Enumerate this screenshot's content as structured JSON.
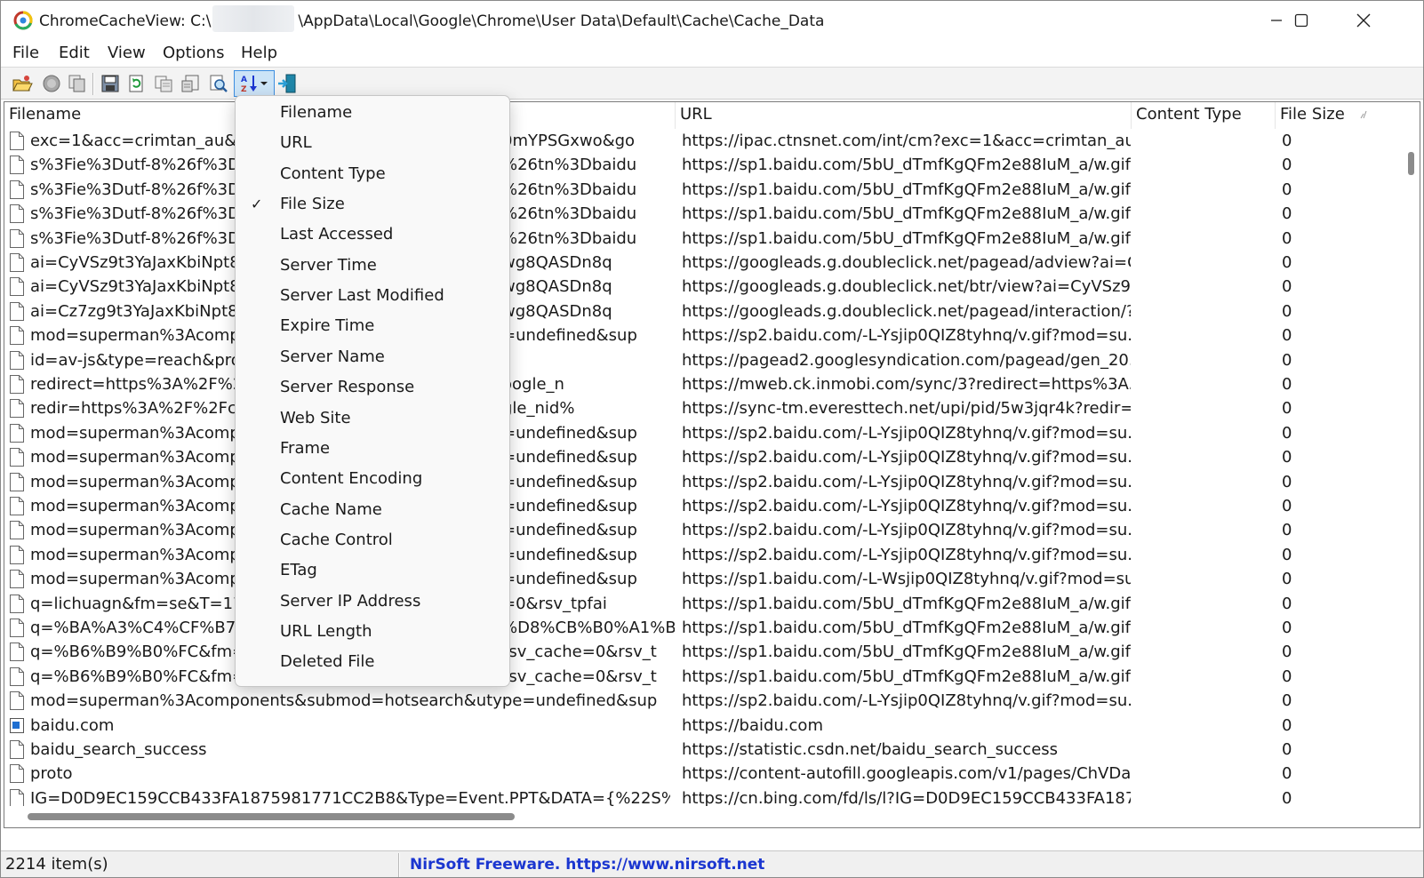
{
  "window": {
    "title_prefix": "ChromeCacheView:  C:\\",
    "title_suffix": "\\AppData\\Local\\Google\\Chrome\\User Data\\Default\\Cache\\Cache_Data"
  },
  "menu": [
    "File",
    "Edit",
    "View",
    "Options",
    "Help"
  ],
  "toolbar": {
    "icons": [
      "open-folder-icon",
      "stop-icon",
      "copy-files-icon",
      "save-icon",
      "refresh-icon",
      "copy-icon",
      "html-report-icon",
      "properties-icon",
      "find-icon",
      "sort-icon",
      "exit-icon"
    ]
  },
  "columns": {
    "filename": "Filename",
    "url": "URL",
    "content_type": "Content Type",
    "file_size": "File Size"
  },
  "rows": [
    {
      "name": "exc=1&acc=crimtan_au&g",
      "name_tail": "0mYPSGxwo&go",
      "url": "https://ipac.ctnsnet.com/int/cm?exc=1&acc=crimtan_au...",
      "size": "0"
    },
    {
      "name": "s%3Fie%3Dutf-8%26f%3D3",
      "name_tail": "%26tn%3Dbaidu",
      "url": "https://sp1.baidu.com/5bU_dTmfKgQFm2e88IuM_a/w.gif...",
      "size": "0"
    },
    {
      "name": "s%3Fie%3Dutf-8%26f%3D3",
      "name_tail": "%26tn%3Dbaidu",
      "url": "https://sp1.baidu.com/5bU_dTmfKgQFm2e88IuM_a/w.gif...",
      "size": "0"
    },
    {
      "name": "s%3Fie%3Dutf-8%26f%3D3",
      "name_tail": "%26tn%3Dbaidu",
      "url": "https://sp1.baidu.com/5bU_dTmfKgQFm2e88IuM_a/w.gif...",
      "size": "0"
    },
    {
      "name": "s%3Fie%3Dutf-8%26f%3D3",
      "name_tail": "%26tn%3Dbaidu",
      "url": "https://sp1.baidu.com/5bU_dTmfKgQFm2e88IuM_a/w.gif...",
      "size": "0"
    },
    {
      "name": "ai=CyVSz9t3YaJaxKbiNpt8I",
      "name_tail": "wg8QASDn8q",
      "url": "https://googleads.g.doubleclick.net/pagead/adview?ai=C...",
      "size": "0"
    },
    {
      "name": "ai=CyVSz9t3YaJaxKbiNpt8I",
      "name_tail": "wg8QASDn8q",
      "url": "https://googleads.g.doubleclick.net/btr/view?ai=CyVSz9t...",
      "size": "0"
    },
    {
      "name": "ai=Cz7zg9t3YaJaxKbiNpt8I",
      "name_tail": "wg8QASDn8q",
      "url": "https://googleads.g.doubleclick.net/pagead/interaction/?...",
      "size": "0"
    },
    {
      "name": "mod=superman%3Acompo",
      "name_tail": "=undefined&sup",
      "url": "https://sp2.baidu.com/-L-Ysjip0QIZ8tyhnq/v.gif?mod=su...",
      "size": "0"
    },
    {
      "name": "id=av-js&type=reach&pro",
      "name_tail": "",
      "url": "https://pagead2.googlesyndication.com/pagead/gen_20...",
      "size": "0"
    },
    {
      "name": "redirect=https%3A%2F%2I",
      "name_tail": "oogle_n",
      "url": "https://mweb.ck.inmobi.com/sync/3?redirect=https%3A...",
      "size": "0"
    },
    {
      "name": "redir=https%3A%2F%2Fcm",
      "name_tail": "gle_nid%",
      "url": "https://sync-tm.everesttech.net/upi/pid/5w3jqr4k?redir=...",
      "size": "0"
    },
    {
      "name": "mod=superman%3Acompo",
      "name_tail": "=undefined&sup",
      "url": "https://sp2.baidu.com/-L-Ysjip0QIZ8tyhnq/v.gif?mod=su...",
      "size": "0"
    },
    {
      "name": "mod=superman%3Acompo",
      "name_tail": "=undefined&sup",
      "url": "https://sp2.baidu.com/-L-Ysjip0QIZ8tyhnq/v.gif?mod=su...",
      "size": "0"
    },
    {
      "name": "mod=superman%3Acompo",
      "name_tail": "=undefined&sup",
      "url": "https://sp2.baidu.com/-L-Ysjip0QIZ8tyhnq/v.gif?mod=su...",
      "size": "0"
    },
    {
      "name": "mod=superman%3Acompo",
      "name_tail": "=undefined&sup",
      "url": "https://sp2.baidu.com/-L-Ysjip0QIZ8tyhnq/v.gif?mod=su...",
      "size": "0"
    },
    {
      "name": "mod=superman%3Acompo",
      "name_tail": "=undefined&sup",
      "url": "https://sp2.baidu.com/-L-Ysjip0QIZ8tyhnq/v.gif?mod=su...",
      "size": "0"
    },
    {
      "name": "mod=superman%3Acompo",
      "name_tail": "=undefined&sup",
      "url": "https://sp2.baidu.com/-L-Ysjip0QIZ8tyhnq/v.gif?mod=su...",
      "size": "0"
    },
    {
      "name": "mod=superman%3Acompo",
      "name_tail": "=undefined&sup",
      "url": "https://sp1.baidu.com/-L-Wsjip0QIZ8tyhnq/v.gif?mod=su...",
      "size": "0"
    },
    {
      "name": "q=lichuagn&fm=se&T=17",
      "name_tail": "=0&rsv_tpfai",
      "url": "https://sp1.baidu.com/5bU_dTmfKgQFm2e88IuM_a/w.gif...",
      "size": "0"
    },
    {
      "name": "q=%BA%A3%C4%CF%B7%",
      "name_tail": "%D8%CB%B0%A1%B...",
      "url": "https://sp1.baidu.com/5bU_dTmfKgQFm2e88IuM_a/w.gif...",
      "size": "0"
    },
    {
      "name": "q=%B6%B9%B0%FC&fm=s",
      "name_tail": "rsv_cache=0&rsv_t",
      "url": "https://sp1.baidu.com/5bU_dTmfKgQFm2e88IuM_a/w.gif...",
      "size": "0"
    },
    {
      "name": "q=%B6%B9%B0%FC&fm=s",
      "name_tail": "rsv_cache=0&rsv_t",
      "url": "https://sp1.baidu.com/5bU_dTmfKgQFm2e88IuM_a/w.gif...",
      "size": "0"
    },
    {
      "name": "mod=superman%3Acomponents&submod=hotsearch&utype=undefined&sup",
      "name_tail": "",
      "url": "https://sp2.baidu.com/-L-Ysjip0QIZ8tyhnq/v.gif?mod=su...",
      "size": "0"
    },
    {
      "name": "baidu.com",
      "name_tail": "",
      "url": "https://baidu.com",
      "size": "0"
    },
    {
      "name": "baidu_search_success",
      "name_tail": "",
      "url": "https://statistic.csdn.net/baidu_search_success",
      "size": "0"
    },
    {
      "name": "proto",
      "name_tail": "",
      "url": "https://content-autofill.googleapis.com/v1/pages/ChVDa...",
      "size": "0"
    },
    {
      "name": "IG=D0D9EC159CCB433FA1875981771CC2B8&Type=Event.PPT&DATA={%22S%",
      "name_tail": "",
      "url": "https://cn.bing.com/fd/ls/l?IG=D0D9EC159CCB433FA187...",
      "size": "0"
    }
  ],
  "dropdown": {
    "items": [
      {
        "label": "Filename",
        "checked": false
      },
      {
        "label": "URL",
        "checked": false
      },
      {
        "label": "Content Type",
        "checked": false
      },
      {
        "label": "File Size",
        "checked": true
      },
      {
        "label": "Last Accessed",
        "checked": false
      },
      {
        "label": "Server Time",
        "checked": false
      },
      {
        "label": "Server Last Modified",
        "checked": false
      },
      {
        "label": "Expire Time",
        "checked": false
      },
      {
        "label": "Server Name",
        "checked": false
      },
      {
        "label": "Server Response",
        "checked": false
      },
      {
        "label": "Web Site",
        "checked": false
      },
      {
        "label": "Frame",
        "checked": false
      },
      {
        "label": "Content Encoding",
        "checked": false
      },
      {
        "label": "Cache Name",
        "checked": false
      },
      {
        "label": "Cache Control",
        "checked": false
      },
      {
        "label": "ETag",
        "checked": false
      },
      {
        "label": "Server IP Address",
        "checked": false
      },
      {
        "label": "URL Length",
        "checked": false
      },
      {
        "label": "Deleted File",
        "checked": false
      }
    ],
    "check_glyph": "✓"
  },
  "status": {
    "count": "2214 item(s)",
    "link": "NirSoft Freeware. https://www.nirsoft.net"
  },
  "colors": {
    "link": "#1b36d0",
    "accent": "#3d8ee0"
  }
}
